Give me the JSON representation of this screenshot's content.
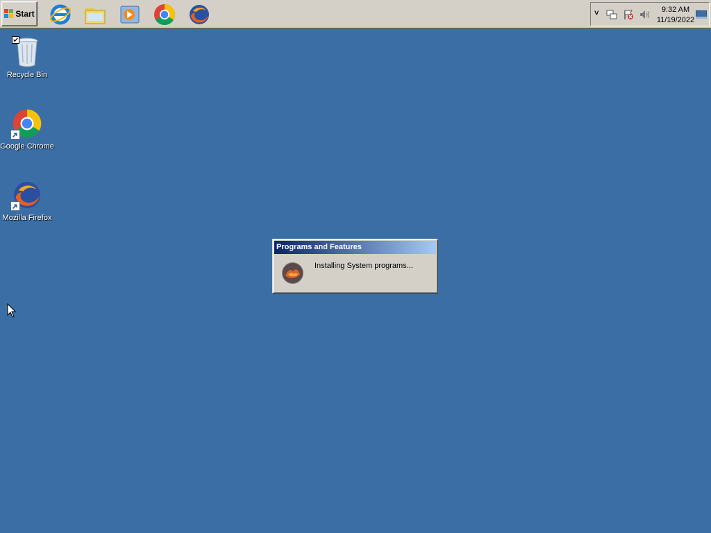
{
  "taskbar": {
    "start_label": "Start",
    "quick_launch": [
      "internet-explorer-icon",
      "explorer-folder-icon",
      "media-player-icon",
      "chrome-icon",
      "firefox-icon"
    ],
    "tray_icons": [
      "network-icon",
      "action-center-icon",
      "volume-icon"
    ],
    "clock_time": "9:32 AM",
    "clock_date": "11/19/2022"
  },
  "desktop": {
    "background_color": "#3a6ea5",
    "icons": [
      {
        "label": "Recycle Bin",
        "icon": "recycle-bin-icon"
      },
      {
        "label": "Google Chrome",
        "icon": "chrome-icon"
      },
      {
        "label": "Mozilla Firefox",
        "icon": "firefox-icon"
      }
    ]
  },
  "dialog": {
    "title": "Programs and Features",
    "message": "Installing System programs...",
    "icon": "installer-icon"
  }
}
